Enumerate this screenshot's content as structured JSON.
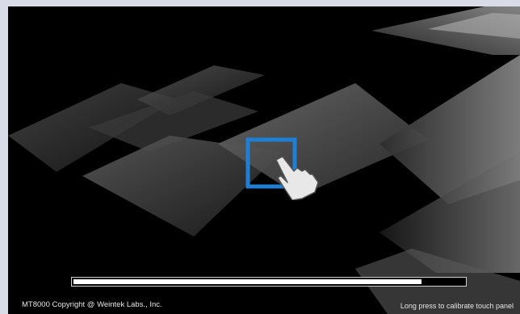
{
  "splash": {
    "progress": 0.89,
    "copyright_text": "MT8000 Copyright @ Weintek Labs., Inc.",
    "calibrate_hint": "Long press to calibrate touch panel"
  },
  "colors": {
    "screen_background": "#000000",
    "frame": "#d9dce8",
    "logo_square": "#1f7fd4",
    "progress_fill": "#ffffff",
    "text": "#e6e6e6"
  },
  "icons": {
    "logo": "touch-hand-icon"
  }
}
